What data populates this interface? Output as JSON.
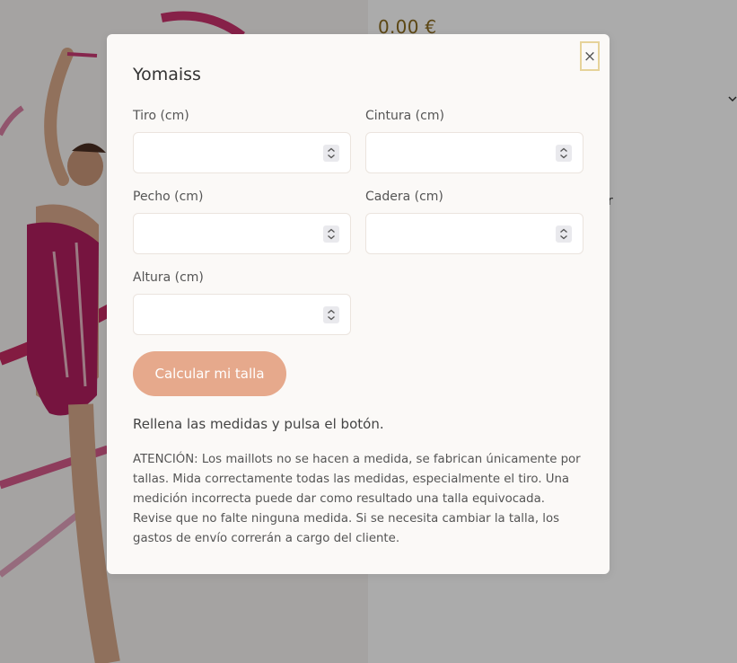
{
  "background": {
    "price": "0.00 €",
    "partial_text": "r"
  },
  "modal": {
    "title": "Yomaiss",
    "close_label": "×",
    "fields": {
      "tiro": {
        "label": "Tiro (cm)",
        "value": "",
        "placeholder": ""
      },
      "cintura": {
        "label": "Cintura (cm)",
        "value": "",
        "placeholder": ""
      },
      "pecho": {
        "label": "Pecho (cm)",
        "value": "",
        "placeholder": ""
      },
      "cadera": {
        "label": "Cadera (cm)",
        "value": "",
        "placeholder": ""
      },
      "altura": {
        "label": "Altura (cm)",
        "value": "",
        "placeholder": ""
      }
    },
    "calculate_button": "Calcular mi talla",
    "hint": "Rellena las medidas y pulsa el botón.",
    "warning": "ATENCIÓN:  Los maillots no se hacen a medida, se fabrican únicamente por tallas. Mida correctamente todas las medidas, especialmente el tiro. Una medición incorrecta puede dar como resultado una talla equivocada. Revise que no falte ninguna medida. Si se necesita cambiar la talla, los gastos de envío correrán a cargo del cliente."
  },
  "colors": {
    "accent_button": "#e6a98c",
    "close_border": "#e6d39a",
    "price": "#8a6a1e",
    "modal_bg": "#fbf9f7"
  },
  "icons": {
    "close": "close-icon",
    "spinner": "number-spinner-icon",
    "chevron": "chevron-down-icon"
  }
}
